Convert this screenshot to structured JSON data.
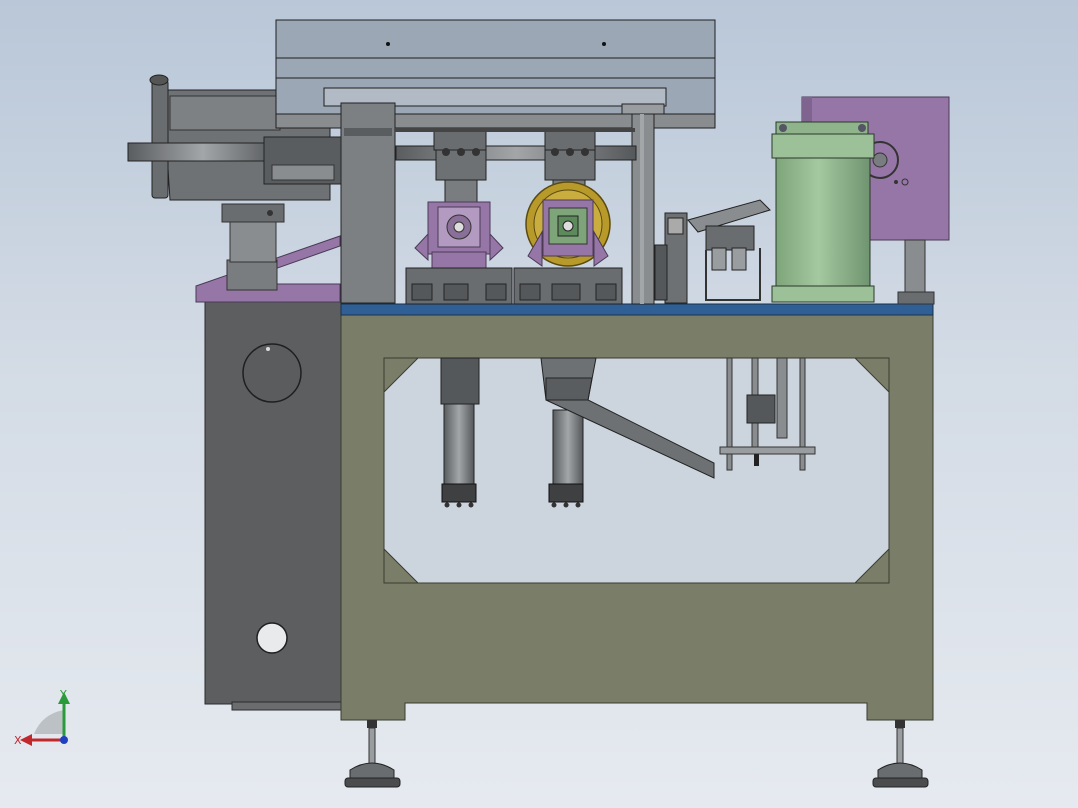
{
  "viewport": {
    "background_top": "#b9c7d8",
    "background_bottom": "#e6eaf0"
  },
  "colors": {
    "frame": "#7a7e68",
    "frame_edge": "#3a3c30",
    "cabinet": "#5c5e60",
    "table_top": "#2f5f94",
    "purple": "#9676a6",
    "purple_dark": "#6e5a80",
    "green": "#8fb48c",
    "gold": "#b89a2a",
    "steel": "#8a8d90",
    "steel_dark": "#55585b"
  },
  "triad": {
    "x_label": "X",
    "y_label": "Y",
    "x_color": "#c0282c",
    "y_color": "#2a9a3a",
    "z_color": "#2040c0"
  }
}
